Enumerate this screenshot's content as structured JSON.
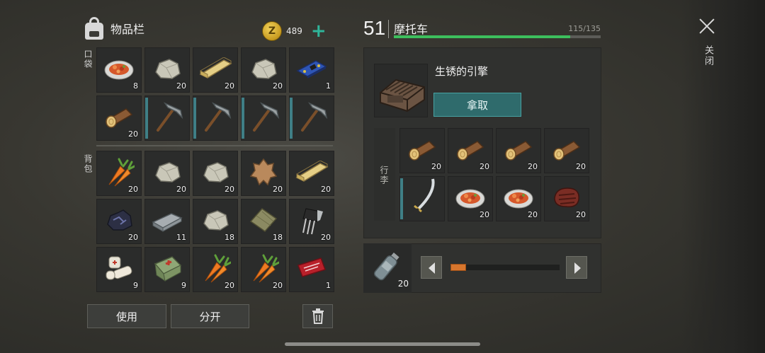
{
  "inventory": {
    "title": "物品栏",
    "coins": "489",
    "coin_letter": "Z",
    "pocket_label": "口袋",
    "backpack_label": "背包",
    "pocket_slots": [
      {
        "item": "food-plate-icon",
        "count": "8"
      },
      {
        "item": "stone-icon",
        "count": "20"
      },
      {
        "item": "plank-icon",
        "count": "20"
      },
      {
        "item": "stone-icon",
        "count": "20"
      },
      {
        "item": "circuit-board-icon",
        "count": "1"
      },
      {
        "item": "log-icon",
        "count": "20"
      },
      {
        "item": "pickaxe-icon",
        "count": ""
      },
      {
        "item": "pickaxe-icon",
        "count": ""
      },
      {
        "item": "pickaxe-icon",
        "count": ""
      },
      {
        "item": "pickaxe-icon",
        "count": ""
      }
    ],
    "backpack_slots": [
      {
        "item": "carrot-icon",
        "count": "20"
      },
      {
        "item": "stone-icon",
        "count": "20"
      },
      {
        "item": "stone-icon",
        "count": "20"
      },
      {
        "item": "leather-hide-icon",
        "count": "20"
      },
      {
        "item": "plank-icon",
        "count": "20"
      },
      {
        "item": "coal-ore-icon",
        "count": "20"
      },
      {
        "item": "iron-ingot-icon",
        "count": "11"
      },
      {
        "item": "stone-icon",
        "count": "18"
      },
      {
        "item": "cloth-icon",
        "count": "18"
      },
      {
        "item": "transistor-icon",
        "count": "20"
      },
      {
        "item": "bandage-icon",
        "count": "9"
      },
      {
        "item": "medkit-bag-icon",
        "count": "9"
      },
      {
        "item": "carrot-icon",
        "count": "20"
      },
      {
        "item": "carrot-icon",
        "count": "20"
      },
      {
        "item": "coupon-ticket-icon",
        "count": "1"
      }
    ],
    "use_button": "使用",
    "split_button": "分开"
  },
  "vehicle": {
    "level": "51",
    "name": "摩托车",
    "capacity": "115/135",
    "capacity_fraction": 0.852,
    "engine_name": "生锈的引擎",
    "take_button": "拿取",
    "trunk_label": "行李",
    "trunk_slots": [
      {
        "item": "log-icon",
        "count": "20"
      },
      {
        "item": "log-icon",
        "count": "20"
      },
      {
        "item": "log-icon",
        "count": "20"
      },
      {
        "item": "log-icon",
        "count": "20"
      },
      {
        "item": "katana-icon",
        "count": ""
      },
      {
        "item": "food-plate-icon",
        "count": "20"
      },
      {
        "item": "food-plate-icon",
        "count": "20"
      },
      {
        "item": "steak-icon",
        "count": "20"
      }
    ]
  },
  "quantity": {
    "item": "water-bottle-icon",
    "count": "20",
    "slider_fraction": 0.1
  },
  "close_label": "关闭",
  "colors": {
    "accent_teal": "#2fb59a",
    "capacity_bar": "#3dbf5d",
    "take_button": "#2f6b6c",
    "slider_knob": "#d8762d",
    "tool_marker": "#3f7f86"
  }
}
